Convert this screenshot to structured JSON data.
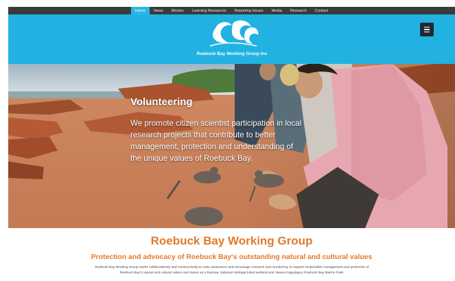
{
  "nav": {
    "items": [
      {
        "label": "Home",
        "active": true
      },
      {
        "label": "News",
        "active": false
      },
      {
        "label": "Movies",
        "active": false
      },
      {
        "label": "Learning Resources",
        "active": false
      },
      {
        "label": "Reporting Issues",
        "active": false
      },
      {
        "label": "Media",
        "active": false
      },
      {
        "label": "Research",
        "active": false
      },
      {
        "label": "Contact",
        "active": false
      }
    ]
  },
  "header": {
    "org_name": "Roebuck Bay Working Group Inc",
    "menu_icon": "hamburger-menu-icon"
  },
  "hero": {
    "title": "Volunteering",
    "text": "We promote citizen scientist participation in local research projects that contribute to better management, protection and understanding of the unique values of Roebuck Bay."
  },
  "intro": {
    "title": "Roebuck Bay Working Group",
    "subtitle": "Protection and advocacy of Roebuck Bay's outstanding natural and cultural values",
    "body": "Roebuck Bay Working Group works collaboratively and constructively to raise awareness and encourage research and monitoring, to support responsible management and protection of Roebuck Bay's natural and cultural values and status as a Ramsar, National Heritage listed wetland and Yawuru Nagulagun Roebuck Bay Marine Park."
  },
  "colors": {
    "brand": "#22b2e1",
    "nav_bg": "#3a3a3a",
    "accent": "#e07a2e"
  }
}
